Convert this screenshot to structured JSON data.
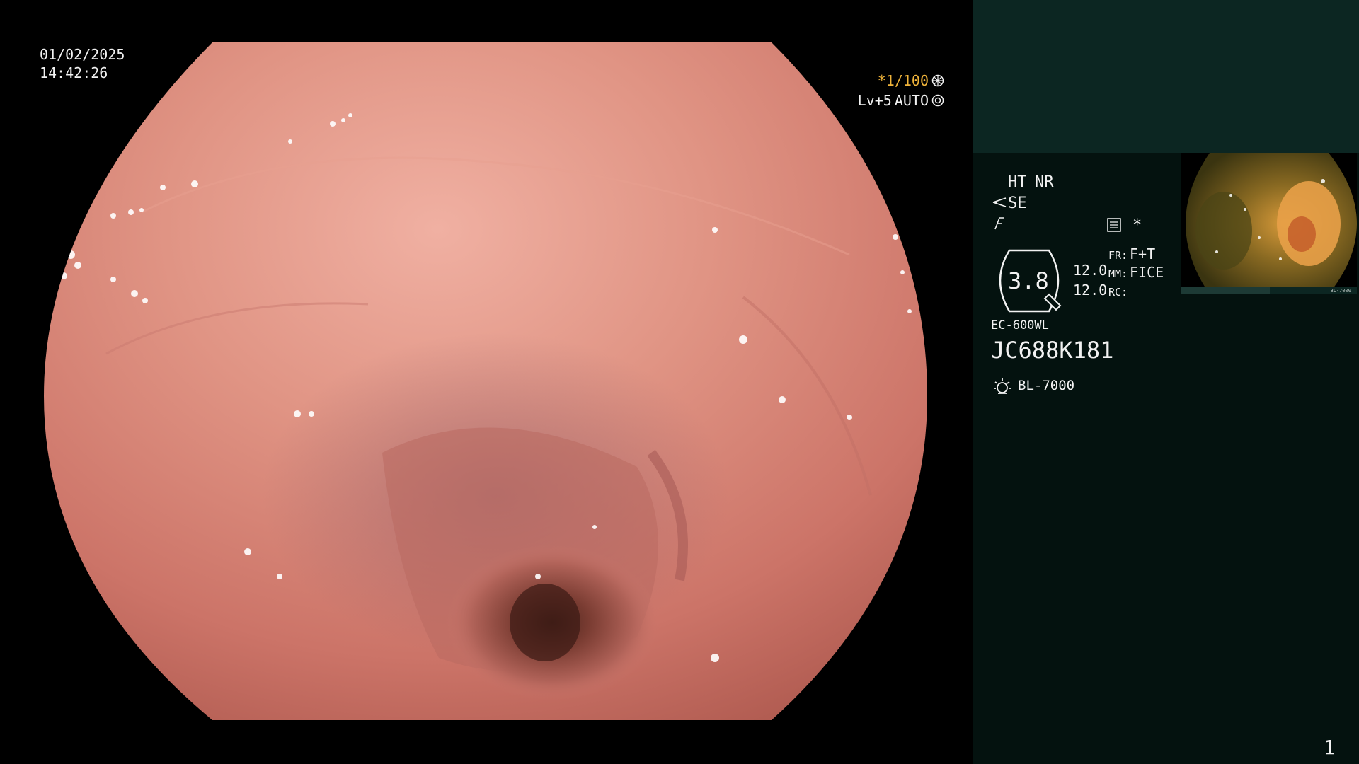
{
  "osd": {
    "date": "01/02/2025",
    "time": "14:42:26",
    "shutter": "*1/100",
    "level": "Lv+5",
    "iris": "AUTO"
  },
  "panel": {
    "ht": "HT",
    "nr": "NR",
    "se": "SE",
    "zoom_value": "3.8",
    "val1": "12.0",
    "val2": "12.0",
    "fr_label": "FR:",
    "fr_value": "F+T",
    "mm_label": "MM:",
    "mm_value": "FICE",
    "rc_label": "RC:",
    "asterisk": "*",
    "scope_model": "EC-600WL",
    "scope_serial": "JC688K181",
    "light_source": "BL-7000",
    "page_number": "1"
  },
  "colors": {
    "accent_amber": "#f0b43a",
    "panel_top": "#0c2622",
    "panel_bg": "#04120f",
    "mucosa": "#d88277"
  },
  "icons": [
    "shutter-icon",
    "iris-icon",
    "scissors-icon",
    "edge-icon",
    "settings-icon",
    "zoom-icon",
    "light-icon"
  ]
}
